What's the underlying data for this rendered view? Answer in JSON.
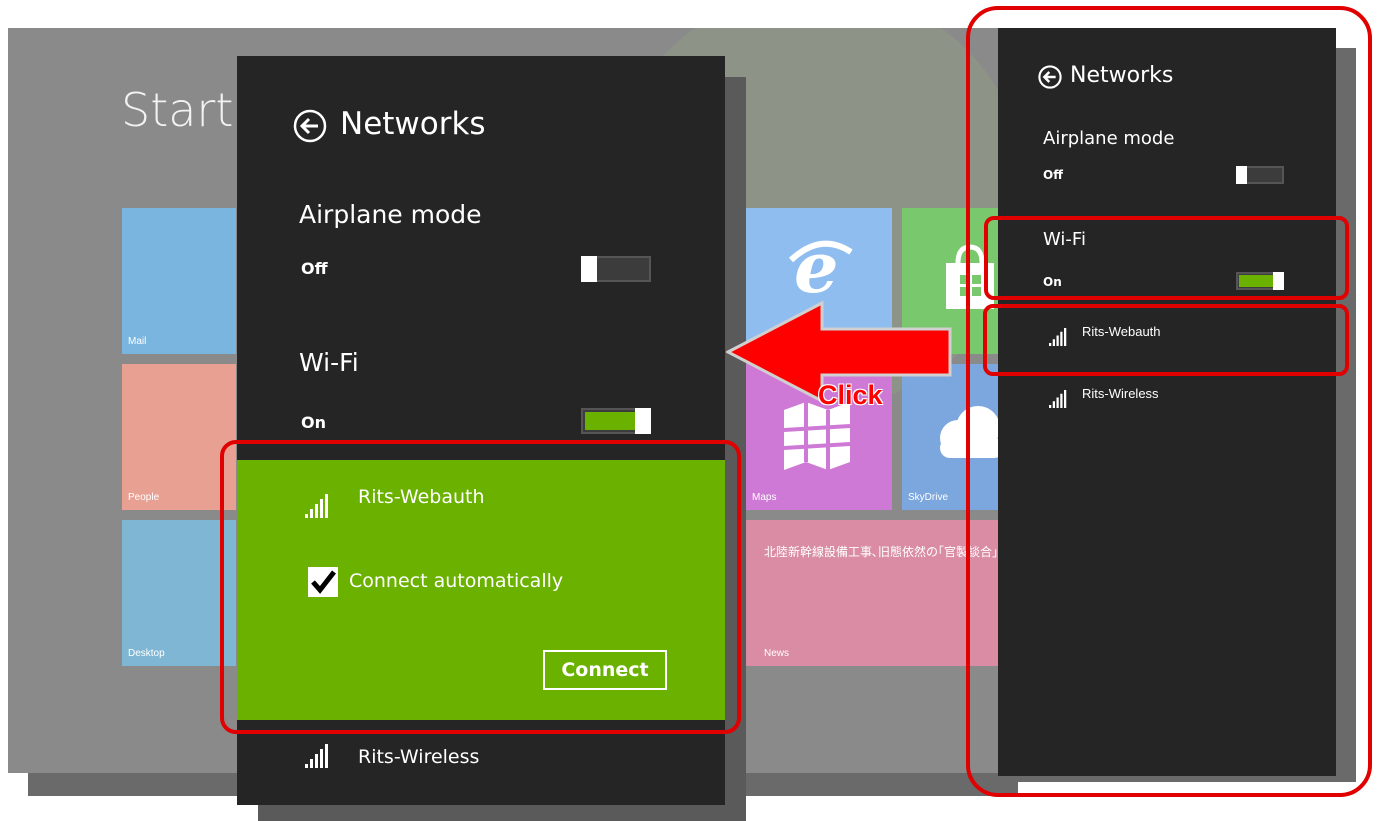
{
  "start": {
    "title": "Start",
    "tiles": [
      {
        "label": "Mail"
      },
      {
        "label": "People"
      },
      {
        "label": "Desktop"
      },
      {
        "label": "Maps"
      },
      {
        "label": "SkyDrive"
      },
      {
        "label": "News"
      },
      {
        "label": "北陸新幹線設備工事､旧態依然の｢官製談合｣"
      }
    ]
  },
  "main_panel": {
    "title": "Networks",
    "airplane": {
      "label": "Airplane mode",
      "state": "Off"
    },
    "wifi": {
      "label": "Wi-Fi",
      "state": "On"
    },
    "selected_network": {
      "name": "Rits-Webauth",
      "auto_connect_label": "Connect automatically",
      "auto_connect": true,
      "connect_label": "Connect"
    },
    "other_network": {
      "name": "Rits-Wireless"
    }
  },
  "side_panel": {
    "title": "Networks",
    "airplane": {
      "label": "Airplane mode",
      "state": "Off"
    },
    "wifi": {
      "label": "Wi-Fi",
      "state": "On"
    },
    "networks": [
      {
        "name": "Rits-Webauth"
      },
      {
        "name": "Rits-Wireless"
      }
    ]
  },
  "annotation": {
    "click_label": "Click"
  },
  "colors": {
    "accent_green": "#6ab100",
    "panel_bg": "#252525",
    "annotation_red": "#e00000"
  }
}
